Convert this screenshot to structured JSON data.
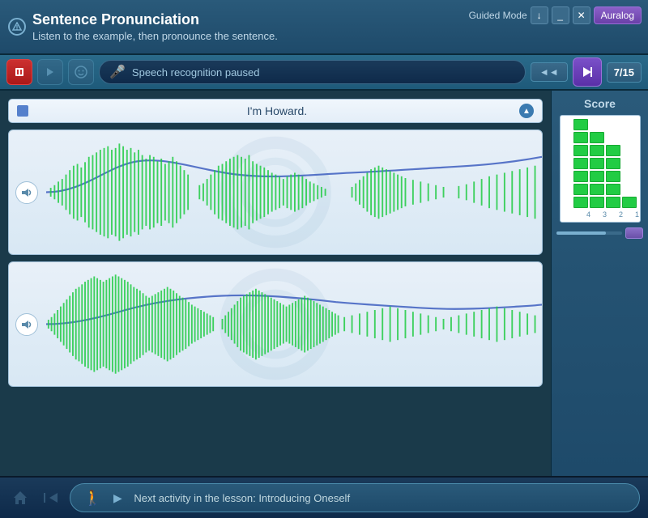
{
  "header": {
    "title": "Sentence Pronunciation",
    "subtitle": "Listen to the example, then pronounce the sentence.",
    "guided_mode": "Guided Mode",
    "auralog": "Auralog"
  },
  "toolbar": {
    "speech_status": "Speech recognition paused",
    "progress": "7/15",
    "back_label": "◄◄"
  },
  "sentence": {
    "text": "I'm Howard."
  },
  "score": {
    "title": "Score",
    "labels": [
      "4",
      "3",
      "2",
      "1"
    ]
  },
  "footer": {
    "next_text": "Next activity in the lesson: Introducing Oneself"
  }
}
